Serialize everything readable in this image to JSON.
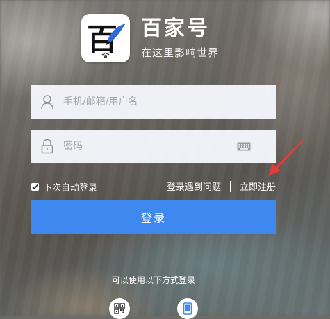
{
  "brand": {
    "name": "百家号",
    "slogan": "在这里影响世界",
    "logo_char": "百"
  },
  "form": {
    "username_placeholder": "手机/邮箱/用户名",
    "password_placeholder": "密码",
    "remember_label": "下次自动登录",
    "remember_checked": true,
    "problem_link": "登录遇到问题",
    "register_link": "立即注册",
    "login_button": "登录"
  },
  "alternatives": {
    "label": "可以使用以下方式登录",
    "methods": [
      "qr-code-icon",
      "phone-icon"
    ]
  },
  "colors": {
    "primary": "#3f88f0",
    "arrow": "#e23b3b"
  }
}
